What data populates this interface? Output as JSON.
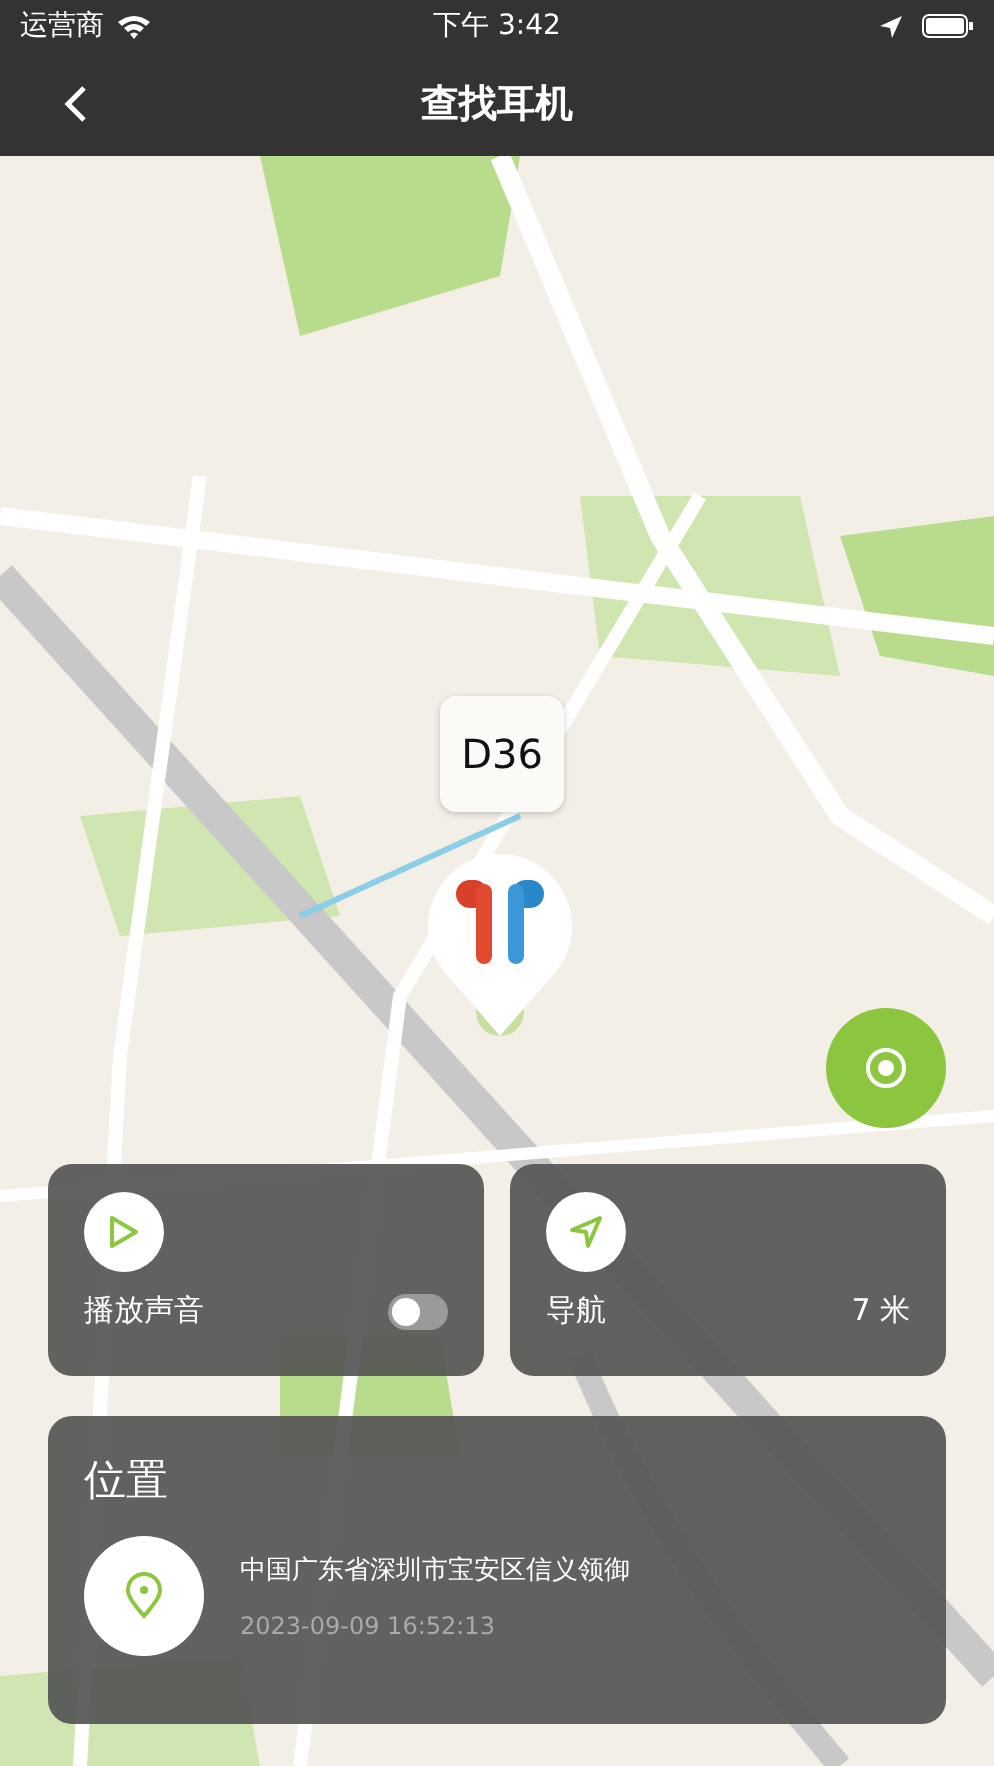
{
  "status_bar": {
    "carrier": "运营商",
    "time": "下午 3:42"
  },
  "nav": {
    "title": "查找耳机"
  },
  "marker": {
    "label": "D36"
  },
  "actions": [
    {
      "kind": "sound",
      "label": "播放声音",
      "on": false
    },
    {
      "kind": "navigate",
      "label": "导航",
      "distance": "7 米"
    }
  ],
  "location": {
    "title": "位置",
    "address": "中国广东省深圳市宝安区信义领御",
    "time": "2023-09-09 16:52:13"
  }
}
